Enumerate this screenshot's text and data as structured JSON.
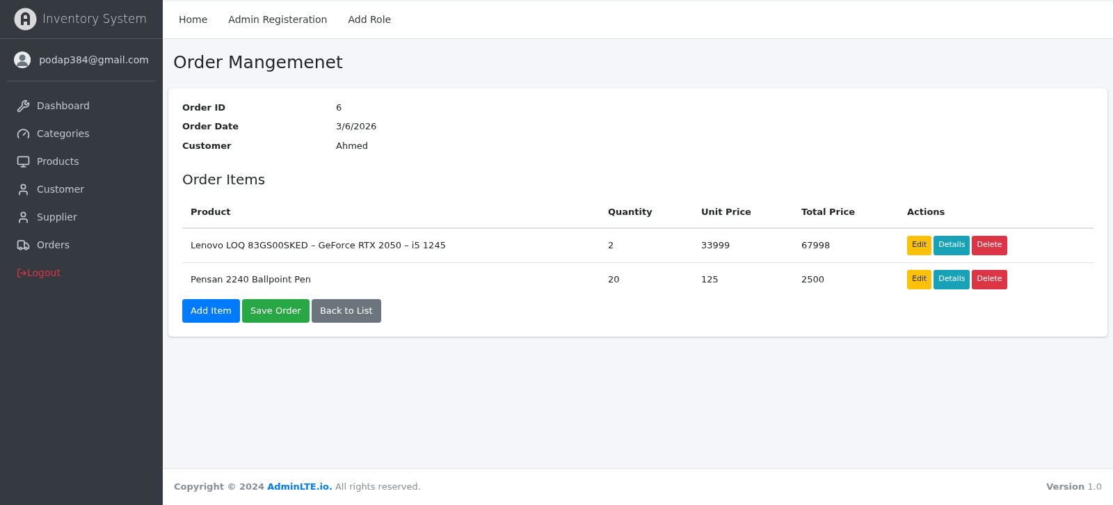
{
  "brand": {
    "title": "Inventory System"
  },
  "user": {
    "email": "podap384@gmail.com"
  },
  "sidebar": {
    "items": [
      {
        "label": "Dashboard",
        "kind": "wrench"
      },
      {
        "label": "Categories",
        "kind": "gauge"
      },
      {
        "label": "Products",
        "kind": "monitor"
      },
      {
        "label": "Customer",
        "kind": "user"
      },
      {
        "label": "Supplier",
        "kind": "user"
      },
      {
        "label": "Orders",
        "kind": "truck"
      },
      {
        "label": "Logout",
        "kind": "logout"
      }
    ]
  },
  "top_nav": [
    "Home",
    "Admin Registeration",
    "Add Role"
  ],
  "page_title": "Order Mangemenet",
  "order": {
    "fields": [
      {
        "label": "Order ID",
        "value": "6"
      },
      {
        "label": "Order Date",
        "value": "3/6/2026"
      },
      {
        "label": "Customer",
        "value": "Ahmed"
      }
    ]
  },
  "items_title": "Order Items",
  "table": {
    "columns": [
      "Product",
      "Quantity",
      "Unit Price",
      "Total Price",
      "Actions"
    ],
    "rows": [
      {
        "cells": [
          "Lenovo LOQ 83GS00SKED – GeForce RTX 2050 – i5 1245",
          "2",
          "33999",
          "67998"
        ],
        "actions": [
          {
            "label": "Edit",
            "kind": "warning"
          },
          {
            "label": "Details",
            "kind": "info"
          },
          {
            "label": "Delete",
            "kind": "danger"
          }
        ]
      },
      {
        "cells": [
          "Pensan 2240 Ballpoint Pen",
          "20",
          "125",
          "2500"
        ],
        "actions": [
          {
            "label": "Edit",
            "kind": "warning"
          },
          {
            "label": "Details",
            "kind": "info"
          },
          {
            "label": "Delete",
            "kind": "danger"
          }
        ]
      }
    ]
  },
  "buttons": [
    {
      "label": "Add Item",
      "kind": "primary"
    },
    {
      "label": "Save Order",
      "kind": "success"
    },
    {
      "label": "Back to List",
      "kind": "secondary"
    }
  ],
  "footer": {
    "copyright": "Copyright © 2024",
    "link": "AdminLTE.io.",
    "rights": "All rights reserved.",
    "version": "**Version** 1.0"
  }
}
